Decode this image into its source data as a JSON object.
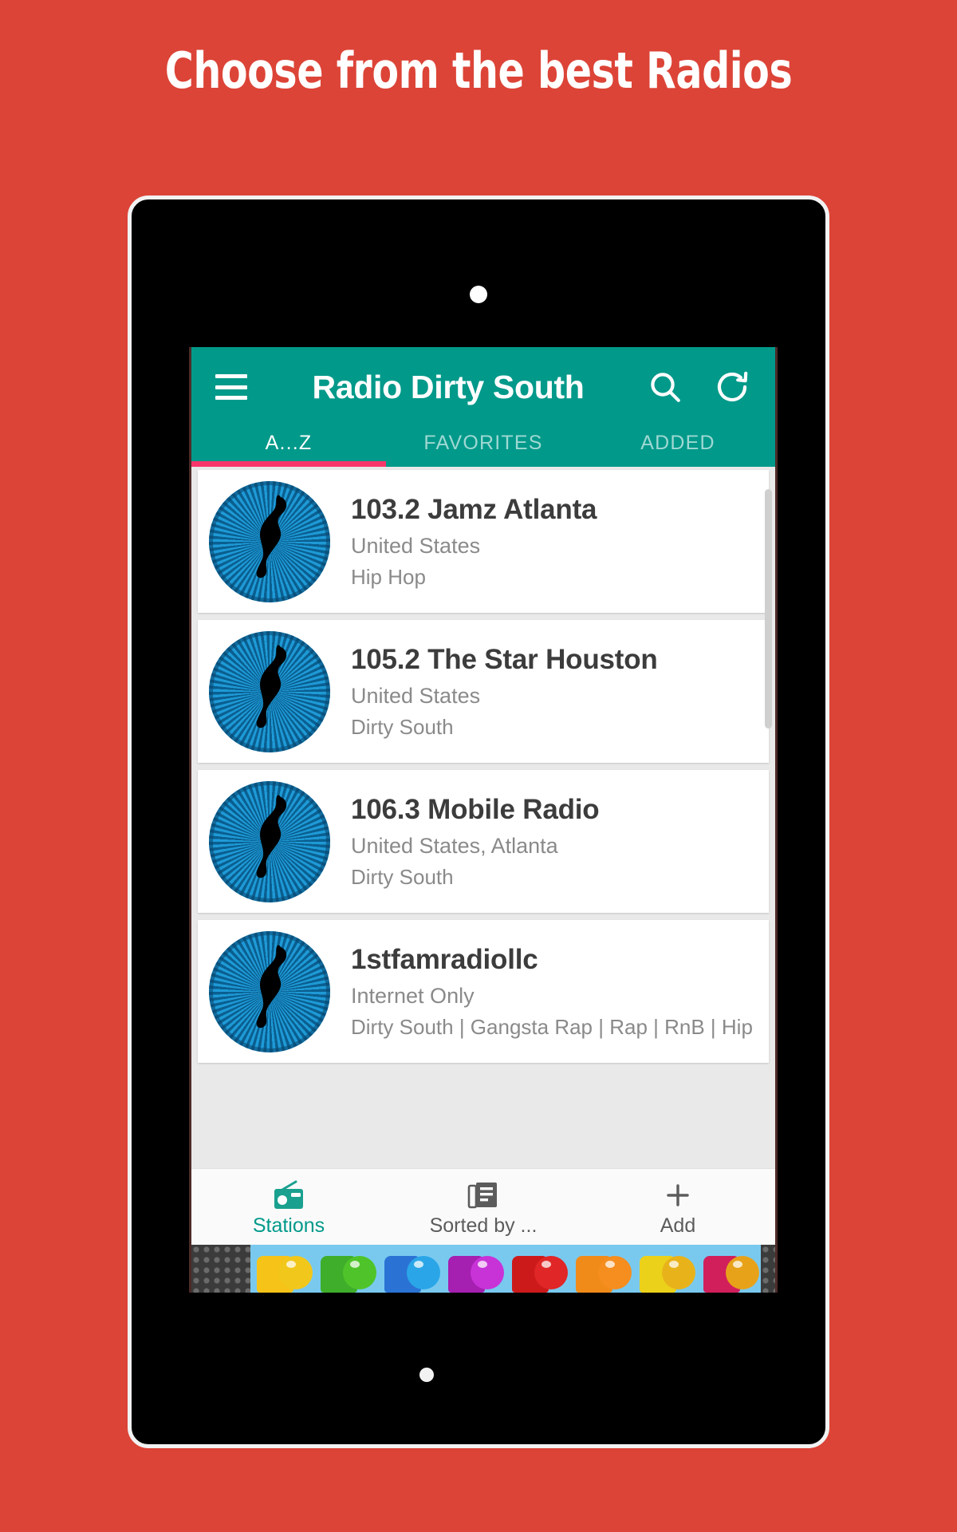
{
  "headline": "Choose from the best Radios",
  "theme": {
    "background": "#dc4437",
    "accent": "#00998a",
    "tab_indicator": "#f8366b",
    "card_bg": "#ffffff",
    "list_bg": "#e9e9e9"
  },
  "appbar": {
    "menu_icon": "hamburger-menu-icon",
    "title": "Radio Dirty South",
    "search_icon": "search-icon",
    "refresh_icon": "refresh-icon"
  },
  "tabs": [
    {
      "label": "A...Z",
      "active": true
    },
    {
      "label": "FAVORITES",
      "active": false
    },
    {
      "label": "ADDED",
      "active": false
    }
  ],
  "stations": [
    {
      "name": "103.2 Jamz Atlanta",
      "country": "United States",
      "genre": "Hip Hop"
    },
    {
      "name": "105.2 The Star Houston",
      "country": "United States",
      "genre": "Dirty South"
    },
    {
      "name": "106.3 Mobile Radio",
      "country": "United States, Atlanta",
      "genre": "Dirty South"
    },
    {
      "name": "1stfamradiollc",
      "country": "Internet Only",
      "genre": "Dirty South | Gangsta Rap | Rap | RnB | Hip"
    }
  ],
  "bottom_nav": [
    {
      "label": "Stations",
      "icon": "radio-icon",
      "active": true
    },
    {
      "label": "Sorted by ...",
      "icon": "list-article-icon",
      "active": false
    },
    {
      "label": "Add",
      "icon": "plus-icon",
      "active": false
    }
  ],
  "ad_banner": {
    "candy_colors": [
      "#f6c418",
      "#3fae2a",
      "#4fbf23",
      "#2a73d4",
      "#2aa6e8",
      "#a51fb0",
      "#c833d8",
      "#cc1a1a",
      "#e02626",
      "#f08a18",
      "#f58d1f",
      "#ecd11b",
      "#e8b31a"
    ],
    "sky_color": "#79c9ef"
  }
}
